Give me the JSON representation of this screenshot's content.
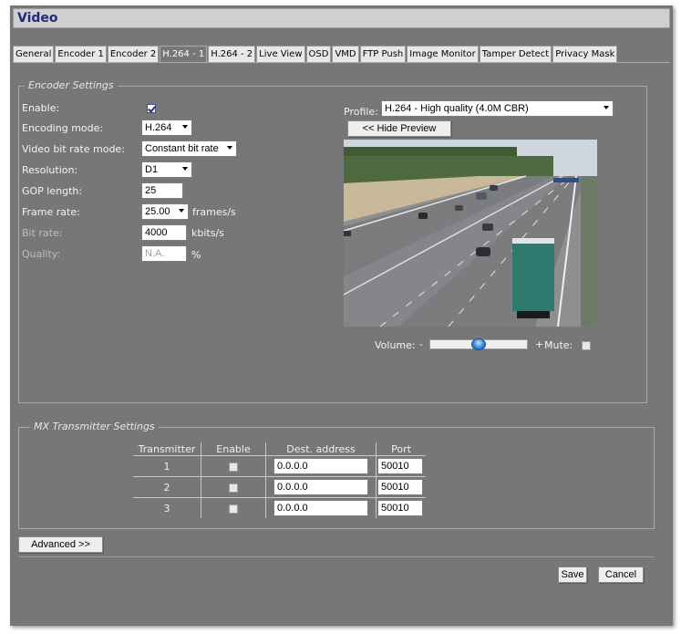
{
  "window": {
    "title": "Video"
  },
  "tabs": [
    "General",
    "Encoder 1",
    "Encoder 2",
    "H.264 - 1",
    "H.264 - 2",
    "Live View",
    "OSD",
    "VMD",
    "FTP Push",
    "Image Monitor",
    "Tamper Detect",
    "Privacy Mask"
  ],
  "active_tab": "H.264 - 1",
  "encoder": {
    "legend": "Encoder Settings",
    "enable_label": "Enable:",
    "enable_checked": true,
    "encoding_mode_label": "Encoding mode:",
    "encoding_mode_value": "H.264",
    "bitrate_mode_label": "Video bit rate mode:",
    "bitrate_mode_value": "Constant bit rate",
    "resolution_label": "Resolution:",
    "resolution_value": "D1",
    "gop_label": "GOP length:",
    "gop_value": "25",
    "frame_rate_label": "Frame rate:",
    "frame_rate_value": "25.00",
    "frame_rate_unit": "frames/s",
    "bit_rate_label": "Bit rate:",
    "bit_rate_value": "4000",
    "bit_rate_unit": "kbits/s",
    "quality_label": "Quality:",
    "quality_value": "N.A.",
    "quality_unit": "%",
    "profile_label": "Profile:",
    "profile_value": "H.264 - High quality (4.0M CBR)",
    "hide_preview_label": "<< Hide Preview",
    "volume_label": "Volume:",
    "volume_minus": "-",
    "volume_plus": "+",
    "volume_level": 0.5,
    "mute_label": "Mute:",
    "mute_checked": false
  },
  "mx": {
    "legend": "MX Transmitter Settings",
    "headers": [
      "Transmitter",
      "Enable",
      "Dest. address",
      "Port"
    ],
    "rows": [
      {
        "transmitter": "1",
        "enabled": false,
        "address": "0.0.0.0",
        "port": "50010"
      },
      {
        "transmitter": "2",
        "enabled": false,
        "address": "0.0.0.0",
        "port": "50010"
      },
      {
        "transmitter": "3",
        "enabled": false,
        "address": "0.0.0.0",
        "port": "50010"
      }
    ]
  },
  "buttons": {
    "advanced": "Advanced >>",
    "save": "Save",
    "cancel": "Cancel"
  },
  "colors": {
    "panel": "#777777",
    "title_text": "#1e2a7a",
    "knob": "#2f7fd8"
  }
}
